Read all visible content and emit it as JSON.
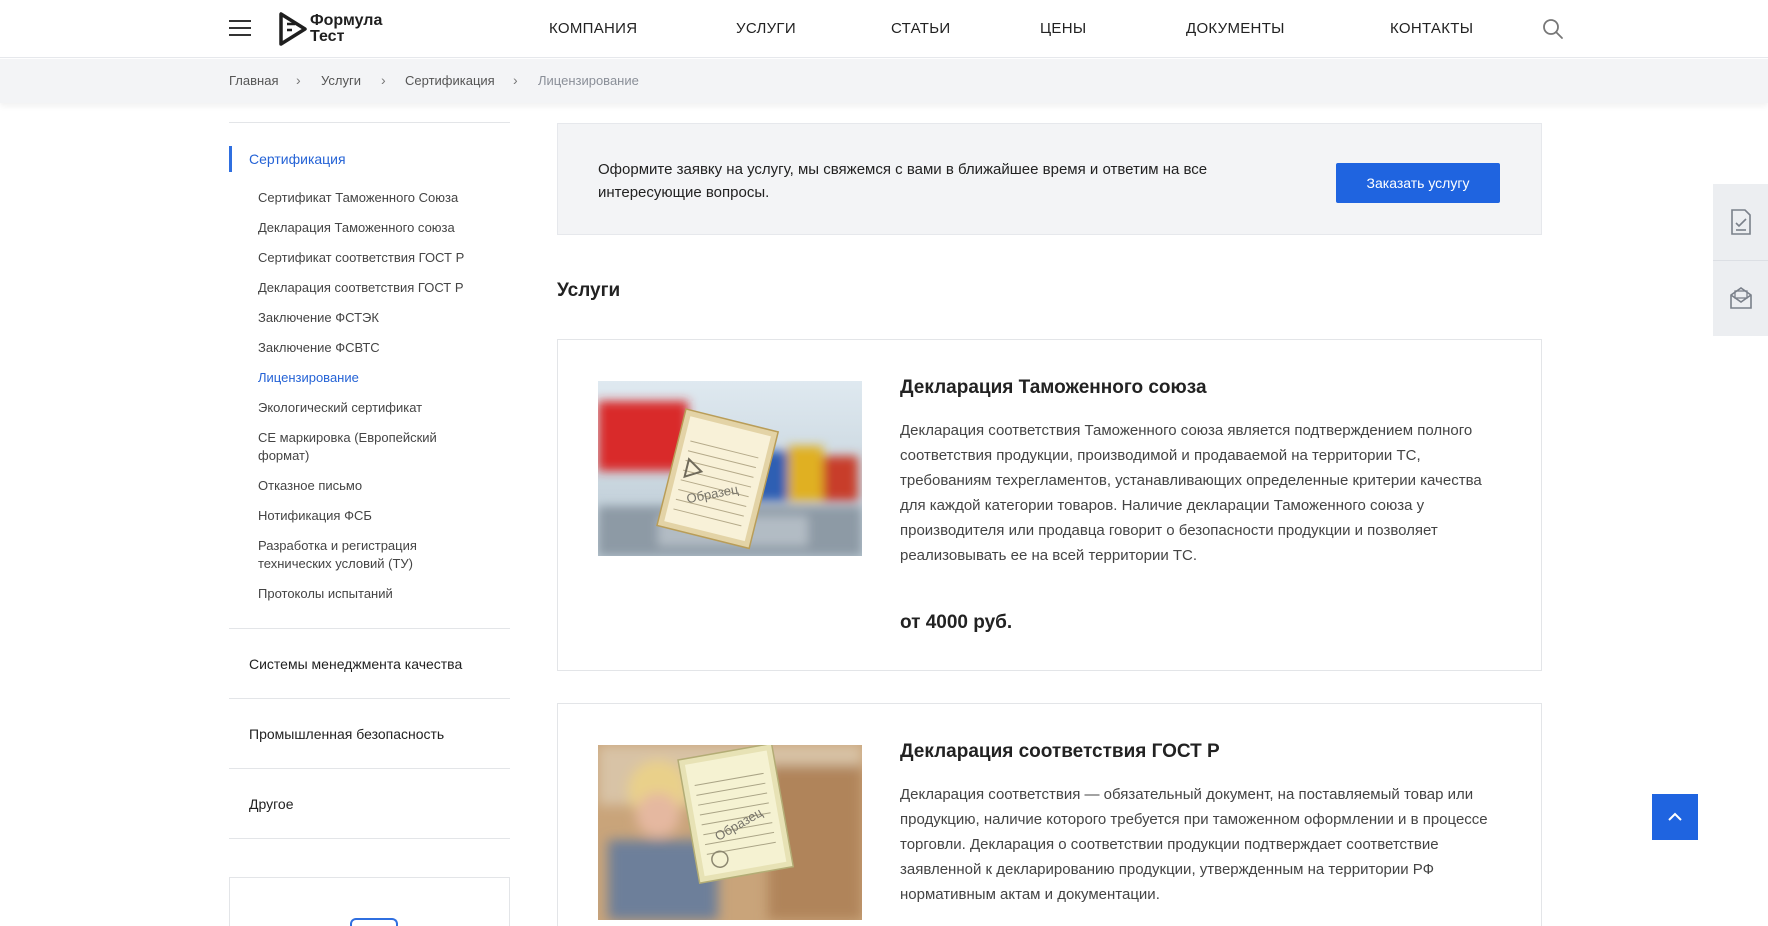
{
  "brand": {
    "logo_line1": "Формула",
    "logo_line2": "Тест"
  },
  "nav": {
    "items": [
      "КОМПАНИЯ",
      "УСЛУГИ",
      "СТАТЬИ",
      "ЦЕНЫ",
      "ДОКУМЕНТЫ",
      "КОНТАКТЫ"
    ]
  },
  "breadcrumb": [
    "Главная",
    "Услуги",
    "Сертификация",
    "Лицензирование"
  ],
  "sidebar": {
    "active_section": "Сертификация",
    "sub_items": [
      "Сертификат Таможенного Союза",
      "Декларация Таможенного союза",
      "Сертификат соответствия ГОСТ Р",
      "Декларация соответствия ГОСТ Р",
      "Заключение ФСТЭК",
      "Заключение ФСВТС",
      "Лицензирование",
      "Экологический сертификат",
      "CE маркировка (Европейский формат)",
      "Отказное письмо",
      "Нотификация ФСБ",
      "Разработка и регистрация технических условий (ТУ)",
      "Протоколы испытаний"
    ],
    "active_sub_item": "Лицензирование",
    "sections": [
      "Системы менеджмента качества",
      "Промышленная безопасность",
      "Другое"
    ]
  },
  "cta": {
    "text": "Оформите заявку на услугу, мы свяжемся с вами в ближайшее время и ответим на все интересующие вопросы.",
    "button_label": "Заказать услугу"
  },
  "services": {
    "title": "Услуги",
    "cards": [
      {
        "title": "Декларация Таможенного союза",
        "description": "Декларация соответствия Таможенного союза является подтверждением полного соответствия продукции, производимой и продаваемой на территории ТС, требованиям техрегламентов, устанавливающих определенные критерии качества для каждой категории товаров. Наличие декларации Таможенного союза у производителя или продавца говорит о безопасности продукции и позволяет реализовывать ее на всей территории ТС.",
        "price": "от 4000 руб.",
        "image_stamp": "Образец"
      },
      {
        "title": "Декларация соответствия ГОСТ Р",
        "description": "Декларация соответствия — обязательный документ, на поставляемый товар или продукцию, наличие которого требуется при таможенном оформлении и в процессе торговли. Декларация о соответствии продукции подтверждает соответствие заявленной к декларированию продукции, утвержденным на территории РФ нормативным актам и документации.",
        "image_stamp": "Образец"
      }
    ]
  },
  "colors": {
    "accent": "#1f64e0",
    "link": "#2563d6",
    "panel_bg": "#f3f4f6"
  },
  "icons": {
    "menu": "hamburger-icon",
    "search": "search-icon",
    "breadcrumb_sep": "chevron-right-icon",
    "float_1": "document-check-icon",
    "float_2": "mail-icon",
    "scroll_top": "chevron-up-icon"
  }
}
